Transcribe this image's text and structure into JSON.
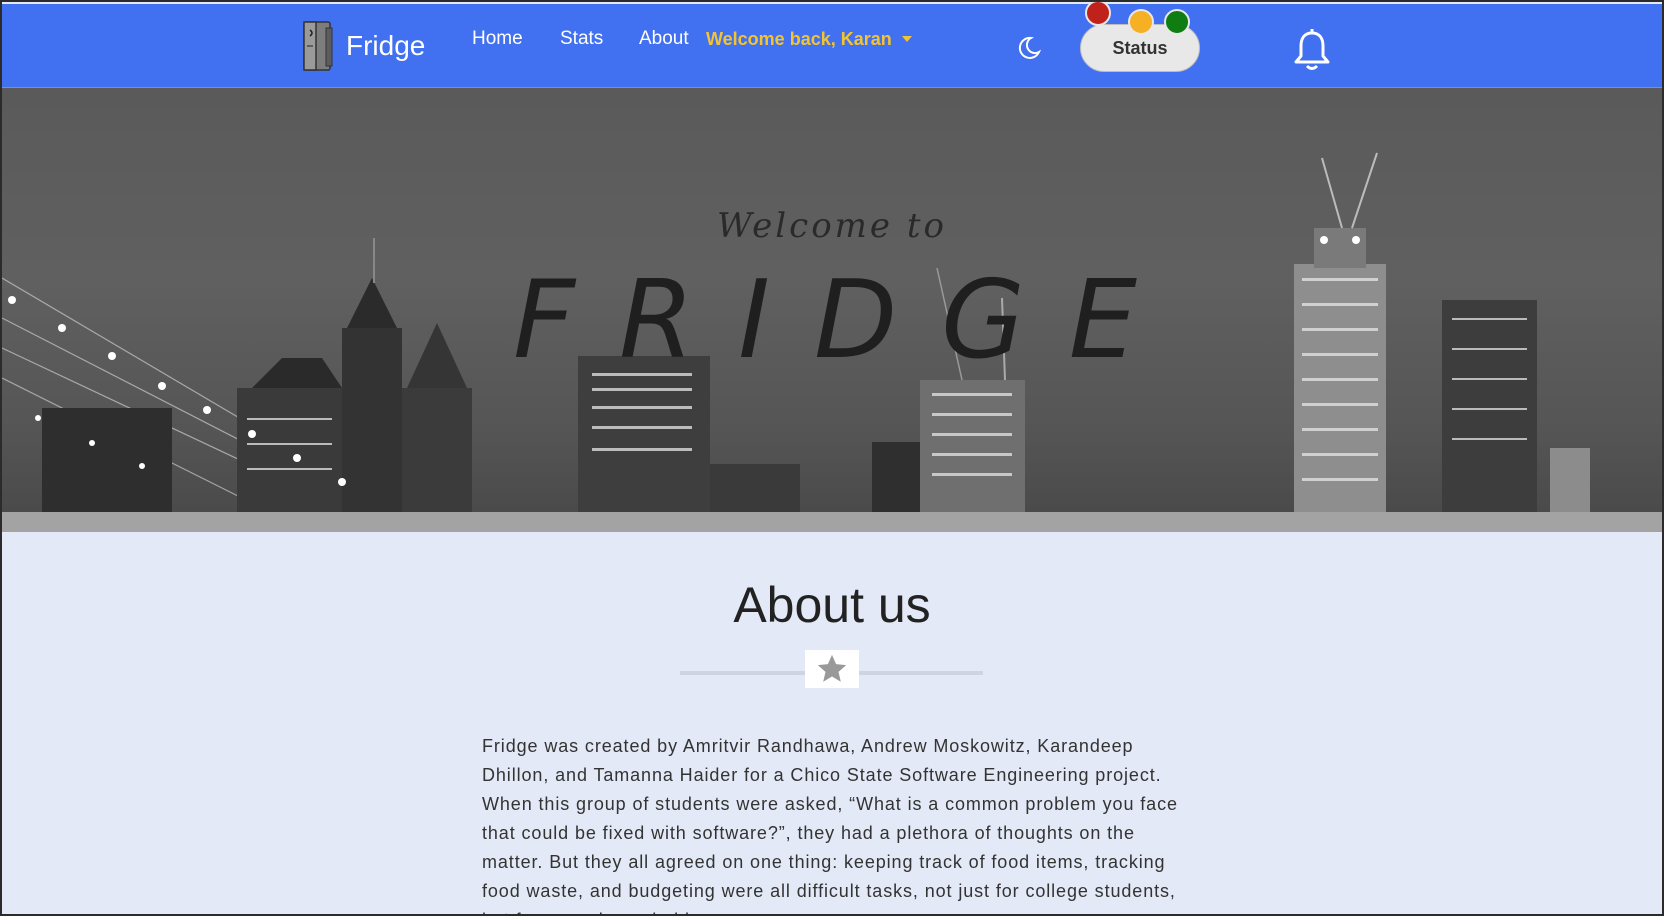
{
  "navbar": {
    "brand": "Fridge",
    "links": [
      "Home",
      "Stats",
      "About"
    ],
    "welcome": "Welcome back, Karan",
    "status_label": "Status",
    "status_dots": [
      "#c0211b",
      "#f5b024",
      "#0f7d12"
    ],
    "colors": {
      "navbar": "#4170f0",
      "welcome_text": "#f4c430"
    }
  },
  "hero": {
    "subtitle": "Welcome to",
    "title": "FRIDGE"
  },
  "about": {
    "title": "About us",
    "body": "Fridge was created by Amritvir Randhawa, Andrew Moskowitz, Karandeep Dhillon, and Tamanna Haider for a Chico State Software Engineering project. When this group of students were asked, “What is a common problem you face that could be fixed with software?”, they had a plethora of thoughts on the matter. But they all agreed on one thing: keeping track of food items, tracking food waste, and budgeting were all difficult tasks, not just for college students, but for many households."
  },
  "icons": [
    "fridge-logo-icon",
    "moon-icon",
    "bell-icon",
    "star-icon",
    "caret-down-icon"
  ]
}
